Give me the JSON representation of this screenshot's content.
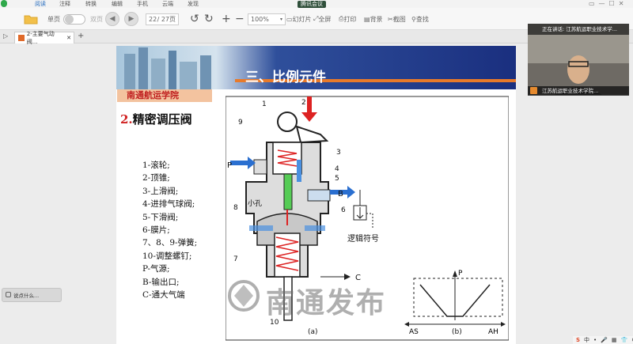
{
  "menubar": {
    "items": [
      "阅读",
      "注释",
      "转换",
      "编辑",
      "手机",
      "云端",
      "发现"
    ]
  },
  "meeting": {
    "label": "腾讯会议"
  },
  "toolbar": {
    "labels": [
      "单页",
      "双页"
    ],
    "page_current": "22",
    "page_total": "/ 27页",
    "zoom": "100%",
    "actions": [
      "幻灯片",
      "全屏",
      "打印",
      "背景",
      "截图",
      "查找"
    ]
  },
  "tabs": [
    {
      "label": "2-主要气动阀..."
    }
  ],
  "slide": {
    "header_title": "三、比例元件",
    "school": "南通航运学院",
    "subtitle_num": "2.",
    "subtitle_text": "精密调压阀",
    "legend": [
      "1-滚轮;",
      "2-顶锥;",
      "3-上滑阀;",
      "4-进排气球阀;",
      "5-下滑阀;",
      "6-膜片;",
      "7、8、9-弹簧;",
      "10-调整螺钉;",
      "P-气源;",
      "B-输出口;",
      "C-通大气端"
    ],
    "diagram": {
      "numbers": [
        "1",
        "2",
        "3",
        "4",
        "5",
        "6",
        "7",
        "8",
        "9",
        "10"
      ],
      "small_hole": "小孔",
      "port_p": "P",
      "port_b": "B",
      "port_c": "C",
      "caption_a": "(a)",
      "caption_b": "(b)",
      "symbol_label": "逻辑符号",
      "graph_p": "P",
      "graph_as": "AS",
      "graph_ah": "AH"
    },
    "watermark": "南通发布"
  },
  "webcam": {
    "status": "正在讲话: 江苏航运职业技术学...",
    "name": "江苏航运职业技术学院..."
  },
  "chat": {
    "label": "说点什么..."
  },
  "tray": {
    "items": [
      "中",
      "•",
      "🎤",
      "▦",
      "👕",
      "⚙"
    ]
  }
}
